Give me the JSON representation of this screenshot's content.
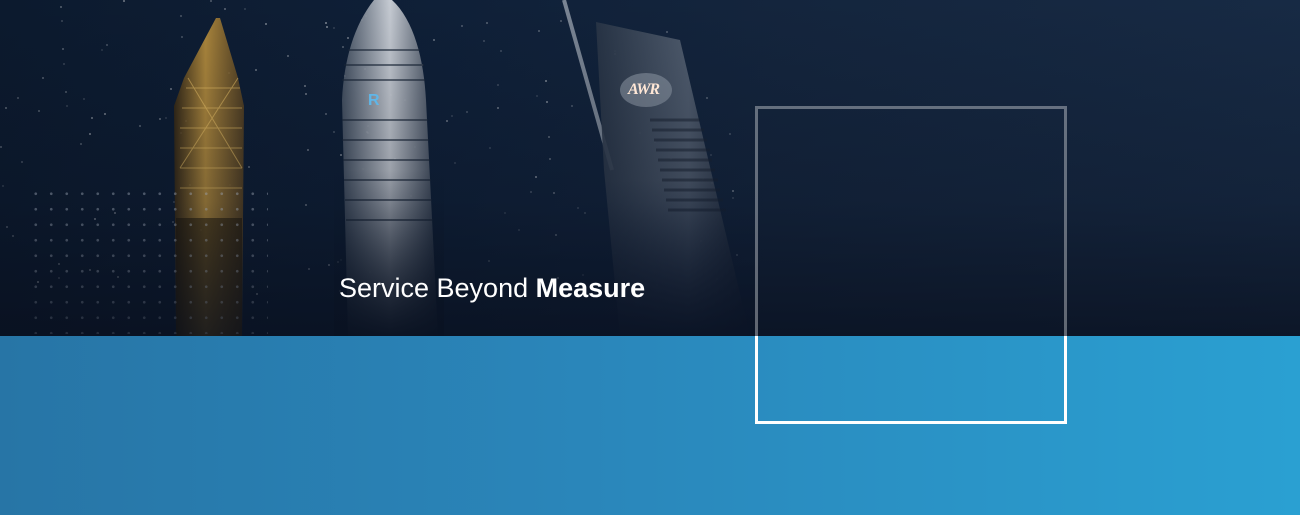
{
  "hero": {
    "tagline_regular": "Service Beyond",
    "tagline_bold": "Measure"
  },
  "towers": {
    "sign_left": "R",
    "sign_right": "AWR"
  },
  "colors": {
    "sky_dark": "#0c1a2e",
    "band_left": "#2775a6",
    "band_right": "#2aa0d2",
    "tower_gold": "#c99a3e",
    "sign_blue": "#5fb6e8",
    "frame": "#ffffff"
  }
}
